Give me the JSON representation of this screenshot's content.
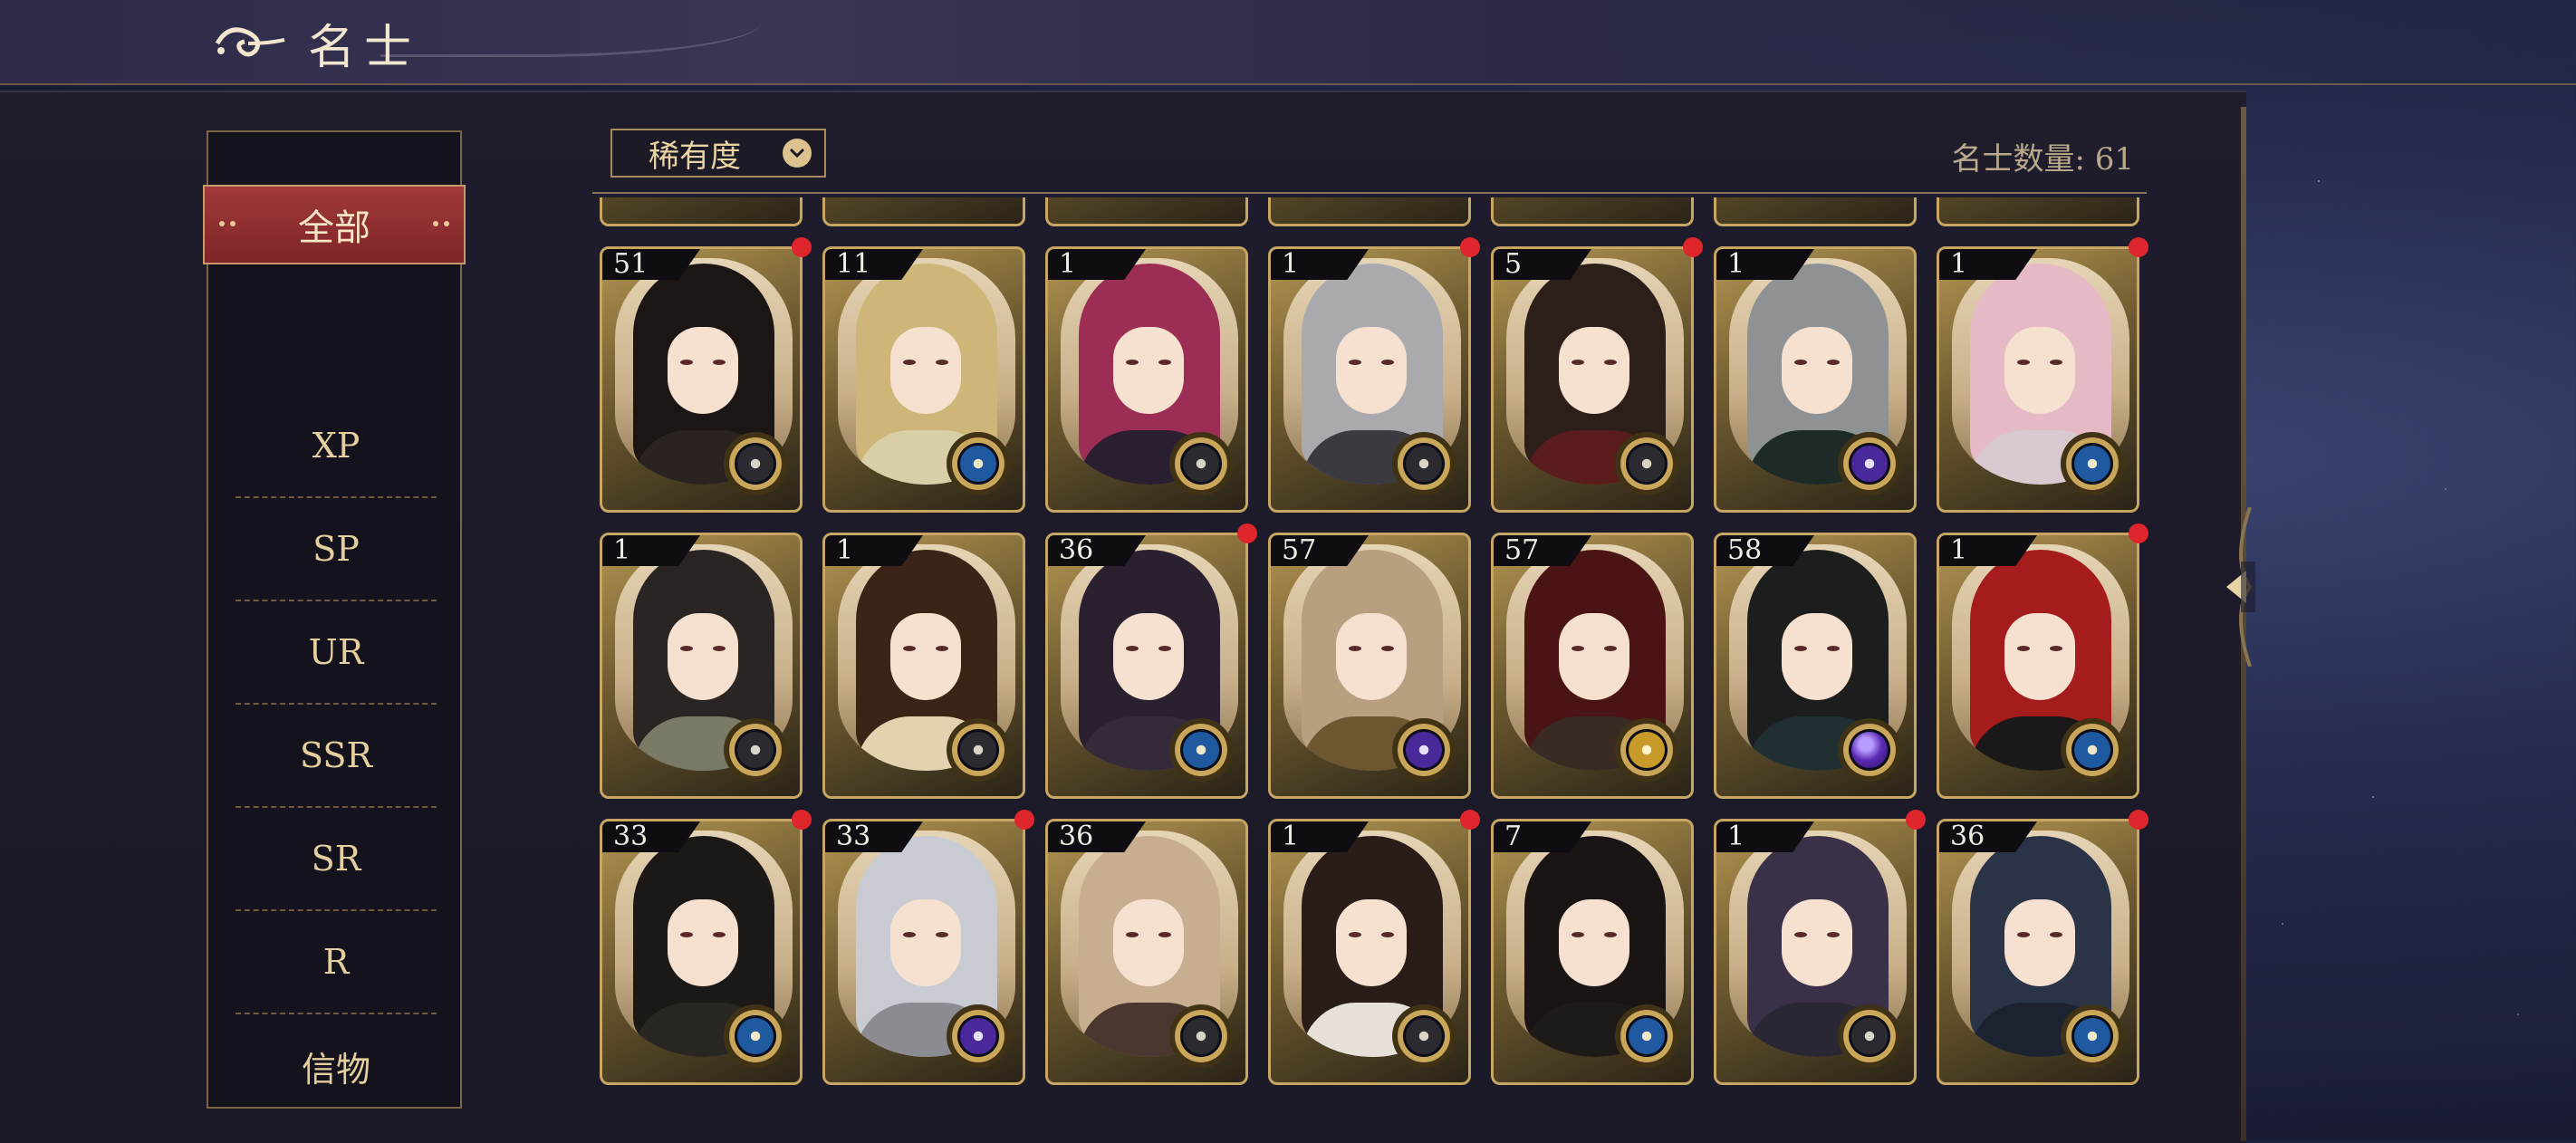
{
  "header": {
    "title": "名士"
  },
  "sidebar": {
    "items": [
      {
        "label": "全部",
        "active": true
      },
      {
        "label": "XP"
      },
      {
        "label": "SP"
      },
      {
        "label": "UR"
      },
      {
        "label": "SSR"
      },
      {
        "label": "SR"
      },
      {
        "label": "R"
      },
      {
        "label": "信物"
      }
    ]
  },
  "filter": {
    "label": "稀有度"
  },
  "count": {
    "text": "名士数量: 61",
    "value": 61
  },
  "colors": {
    "accent_red": "#a0393a",
    "gold": "#c7a664",
    "notify": "#e0262d"
  },
  "cards": [
    {
      "level": "51",
      "badge": "dark-compass",
      "dot": true,
      "hair": "#1b1614",
      "robe": "#2a2320"
    },
    {
      "level": "11",
      "badge": "blue-compass",
      "dot": false,
      "hair": "#cdb678",
      "robe": "#d8cfa9"
    },
    {
      "level": "1",
      "badge": "dark-compass",
      "dot": false,
      "hair": "#9c2d55",
      "robe": "#2a1f30"
    },
    {
      "level": "1",
      "badge": "dark-compass",
      "dot": true,
      "hair": "#a9a9ae",
      "robe": "#3a3a40"
    },
    {
      "level": "5",
      "badge": "dark-compass",
      "dot": true,
      "hair": "#2c1e18",
      "robe": "#5a1c1c"
    },
    {
      "level": "1",
      "badge": "purple-compass",
      "dot": false,
      "hair": "#8e9294",
      "robe": "#1d2a28"
    },
    {
      "level": "1",
      "badge": "blue-compass",
      "dot": true,
      "hair": "#e6b9c6",
      "robe": "#d8c8d0"
    },
    {
      "level": "1",
      "badge": "dark-compass",
      "dot": false,
      "hair": "#2a2422",
      "robe": "#7a7a66"
    },
    {
      "level": "1",
      "badge": "dark-compass",
      "dot": false,
      "hair": "#3a2418",
      "robe": "#e2d2b0"
    },
    {
      "level": "36",
      "badge": "blue-compass",
      "dot": true,
      "hair": "#2a2030",
      "robe": "#352a3a"
    },
    {
      "level": "57",
      "badge": "purple-compass",
      "dot": false,
      "hair": "#b89f80",
      "robe": "#6c5730"
    },
    {
      "level": "57",
      "badge": "gold-compass",
      "dot": false,
      "hair": "#4a1414",
      "robe": "#3a2a24"
    },
    {
      "level": "58",
      "badge": "purple-orb",
      "dot": false,
      "hair": "#1c1e1e",
      "robe": "#203032"
    },
    {
      "level": "1",
      "badge": "blue-compass",
      "dot": true,
      "hair": "#a41c1c",
      "robe": "#1a1818"
    },
    {
      "level": "33",
      "badge": "blue-compass",
      "dot": true,
      "hair": "#1c1816",
      "robe": "#2a2622"
    },
    {
      "level": "33",
      "badge": "purple-compass",
      "dot": true,
      "hair": "#c8ccd2",
      "robe": "#8a8c92"
    },
    {
      "level": "36",
      "badge": "dark-compass",
      "dot": false,
      "hair": "#c9ad90",
      "robe": "#4a3830"
    },
    {
      "level": "1",
      "badge": "dark-compass",
      "dot": true,
      "hair": "#2a1c18",
      "robe": "#e6e0d8"
    },
    {
      "level": "7",
      "badge": "blue-compass",
      "dot": false,
      "hair": "#1a1414",
      "robe": "#1e1a18"
    },
    {
      "level": "1",
      "badge": "dark-compass",
      "dot": true,
      "hair": "#3a3048",
      "robe": "#2a2634"
    },
    {
      "level": "36",
      "badge": "blue-compass",
      "dot": true,
      "hair": "#2a3446",
      "robe": "#1c2230"
    }
  ]
}
